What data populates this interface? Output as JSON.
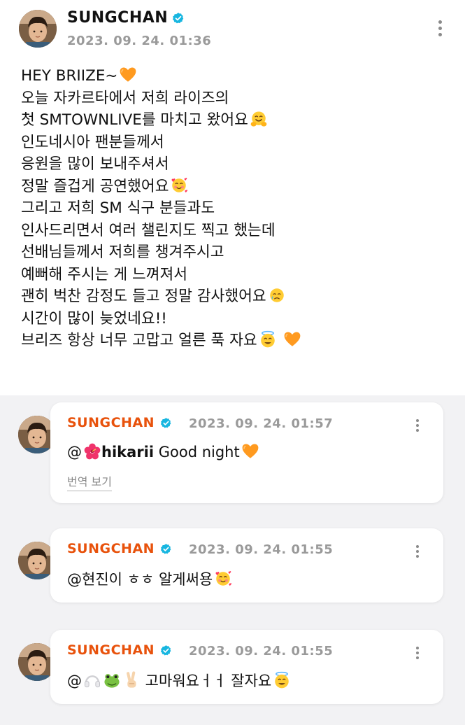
{
  "post": {
    "author": "SUNGCHAN",
    "timestamp": "2023. 09. 24. 01:36",
    "lines": [
      {
        "text": "HEY BRIIZE~",
        "emoji": "orange-heart"
      },
      {
        "text": "오늘 자카르타에서 저희 라이즈의",
        "emoji": ""
      },
      {
        "text": "첫 SMTOWNLIVE를 마치고 왔어요",
        "emoji": "hugging-face"
      },
      {
        "text": "인도네시아 팬분들께서",
        "emoji": ""
      },
      {
        "text": "응원을 많이 보내주셔서",
        "emoji": ""
      },
      {
        "text": "정말 즐겁게 공연했어요",
        "emoji": "smiling-face-with-hearts"
      },
      {
        "text": "그리고 저희 SM 식구 분들과도",
        "emoji": ""
      },
      {
        "text": "인사드리면서 여러 챌린지도 찍고 했는데",
        "emoji": ""
      },
      {
        "text": "선배님들께서 저희를 챙겨주시고",
        "emoji": ""
      },
      {
        "text": "예뻐해 주시는 게 느껴져서",
        "emoji": ""
      },
      {
        "text": "괜히 벅찬 감정도 들고 정말 감사했어요",
        "emoji": "holding-back-tears"
      },
      {
        "text": "시간이 많이 늦었네요!!",
        "emoji": ""
      },
      {
        "text": "브리즈 항상 너무 고맙고 얼른 푹 자요",
        "emoji": "halo-face orange-heart"
      }
    ]
  },
  "replies": [
    {
      "author": "SUNGCHAN",
      "timestamp": "2023. 09. 24. 01:57",
      "mention_prefix": "@",
      "mention_name": "hikarii",
      "mention_emoji": "hibiscus",
      "message": " Good night",
      "end_emoji": "orange-heart",
      "translate_label": "번역 보기"
    },
    {
      "author": "SUNGCHAN",
      "timestamp": "2023. 09. 24. 01:55",
      "mention_prefix": "@현진이",
      "message": " ㅎㅎ 알게써용",
      "end_emoji": "smiling-face-with-hearts"
    },
    {
      "author": "SUNGCHAN",
      "timestamp": "2023. 09. 24. 01:55",
      "mention_prefix": "@",
      "mention_emojis": "headphones frog victory-hand",
      "message": " 고마워요ㅓㅓ 잘자요",
      "end_emoji": "halo-face"
    }
  ],
  "colors": {
    "reply_author": "#e8520c",
    "verified_badge": "#17b6e0",
    "timestamp": "#9a9a9a",
    "background": "#f2f2f4"
  }
}
